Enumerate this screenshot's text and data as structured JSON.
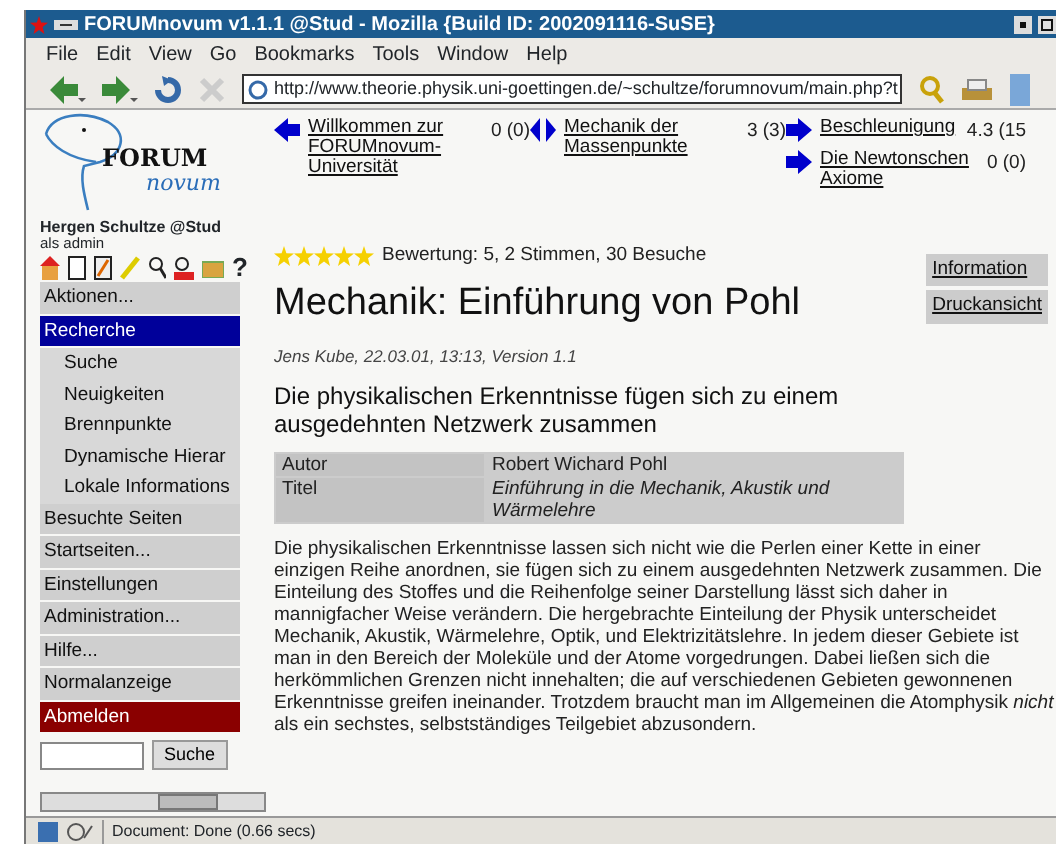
{
  "window": {
    "title": "FORUMnovum v1.1.1 @Stud - Mozilla {Build ID: 2002091116-SuSE}"
  },
  "menu": [
    "File",
    "Edit",
    "View",
    "Go",
    "Bookmarks",
    "Tools",
    "Window",
    "Help"
  ],
  "address": {
    "value": "http://www.theorie.physik.uni-goettingen.de/~schultze/forumnovum/main.php?t"
  },
  "logo": {
    "word": "FORUM",
    "sub": "novum"
  },
  "user": {
    "name": "Hergen Schultze @Stud",
    "role": "als admin"
  },
  "tool_help": "?",
  "nav": [
    {
      "kind": "prev",
      "label": "Willkommen zur FORUMnovum-Universität",
      "count": "0 (0)"
    },
    {
      "kind": "up",
      "label": "Mechanik der Massenpunkte",
      "count": "3 (3)"
    },
    {
      "kind": "next",
      "label": "Beschleunigung",
      "count": "4.3 (15"
    },
    {
      "kind": "next",
      "label": "Die Newtonschen Axiome",
      "count": "0 (0)"
    }
  ],
  "sidebar": {
    "items": [
      {
        "label": "Aktionen...",
        "kind": "section",
        "selected": false
      },
      {
        "label": "Recherche",
        "kind": "section",
        "selected": true
      },
      {
        "label": "Suche",
        "kind": "sub",
        "selected": false
      },
      {
        "label": "Neuigkeiten",
        "kind": "sub",
        "selected": false
      },
      {
        "label": "Brennpunkte",
        "kind": "sub",
        "selected": false
      },
      {
        "label": "Dynamische Hierar",
        "kind": "sub",
        "selected": false
      },
      {
        "label": "Lokale Informations",
        "kind": "sub",
        "selected": false
      },
      {
        "label": "Besuchte Seiten",
        "kind": "section",
        "selected": false
      },
      {
        "label": "Startseiten...",
        "kind": "section",
        "selected": false
      },
      {
        "label": "Einstellungen",
        "kind": "section",
        "selected": false
      },
      {
        "label": "Administration...",
        "kind": "section",
        "selected": false
      },
      {
        "label": "Hilfe...",
        "kind": "section",
        "selected": false
      },
      {
        "label": "Normalanzeige",
        "kind": "section",
        "selected": false
      },
      {
        "label": "Abmelden",
        "kind": "logout",
        "selected": false
      }
    ],
    "search_button": "Suche"
  },
  "rating": {
    "stars": 5,
    "text": "Bewertung: 5, 2 Stimmen, 30 Besuche"
  },
  "side_buttons": [
    "Information",
    "Druckansicht"
  ],
  "article": {
    "title": "Mechanik: Einführung von Pohl",
    "byline": "Jens Kube, 22.03.01, 13:13, Version 1.1",
    "subtitle": "Die physikalischen Erkenntnisse fügen sich zu einem ausgedehnten Netzwerk zusammen",
    "meta": [
      {
        "key": "Autor",
        "value": "Robert Wichard Pohl",
        "italic": false
      },
      {
        "key": "Titel",
        "value": "Einführung in die Mechanik, Akustik und Wärmelehre",
        "italic": true
      }
    ],
    "body": "Die physikalischen Erkenntnisse lassen sich nicht wie die Perlen einer Kette in einer einzigen Reihe anordnen, sie fügen sich zu einem ausgedehnten Netzwerk zusammen. Die Einteilung des Stoffes und die Reihenfolge seiner Darstellung lässt sich daher in mannigfacher Weise verändern. Die hergebrachte Einteilung der Physik unterscheidet Mechanik, Akustik, Wärmelehre, Optik, und Elektrizitätslehre. In jedem dieser Gebiete ist man in den Bereich der Moleküle und der Atome vorgedrungen. Dabei ließen sich die herkömmlichen Grenzen nicht innehalten; die auf verschiedenen Gebieten gewonnenen Erkenntnisse greifen ineinander. Trotzdem braucht man im Allgemeinen die Atomphysik *nicht* als ein sechstes, selbstständiges Teilgebiet abzusondern."
  },
  "status_bar": {
    "text": "Document: Done (0.66 secs)"
  }
}
